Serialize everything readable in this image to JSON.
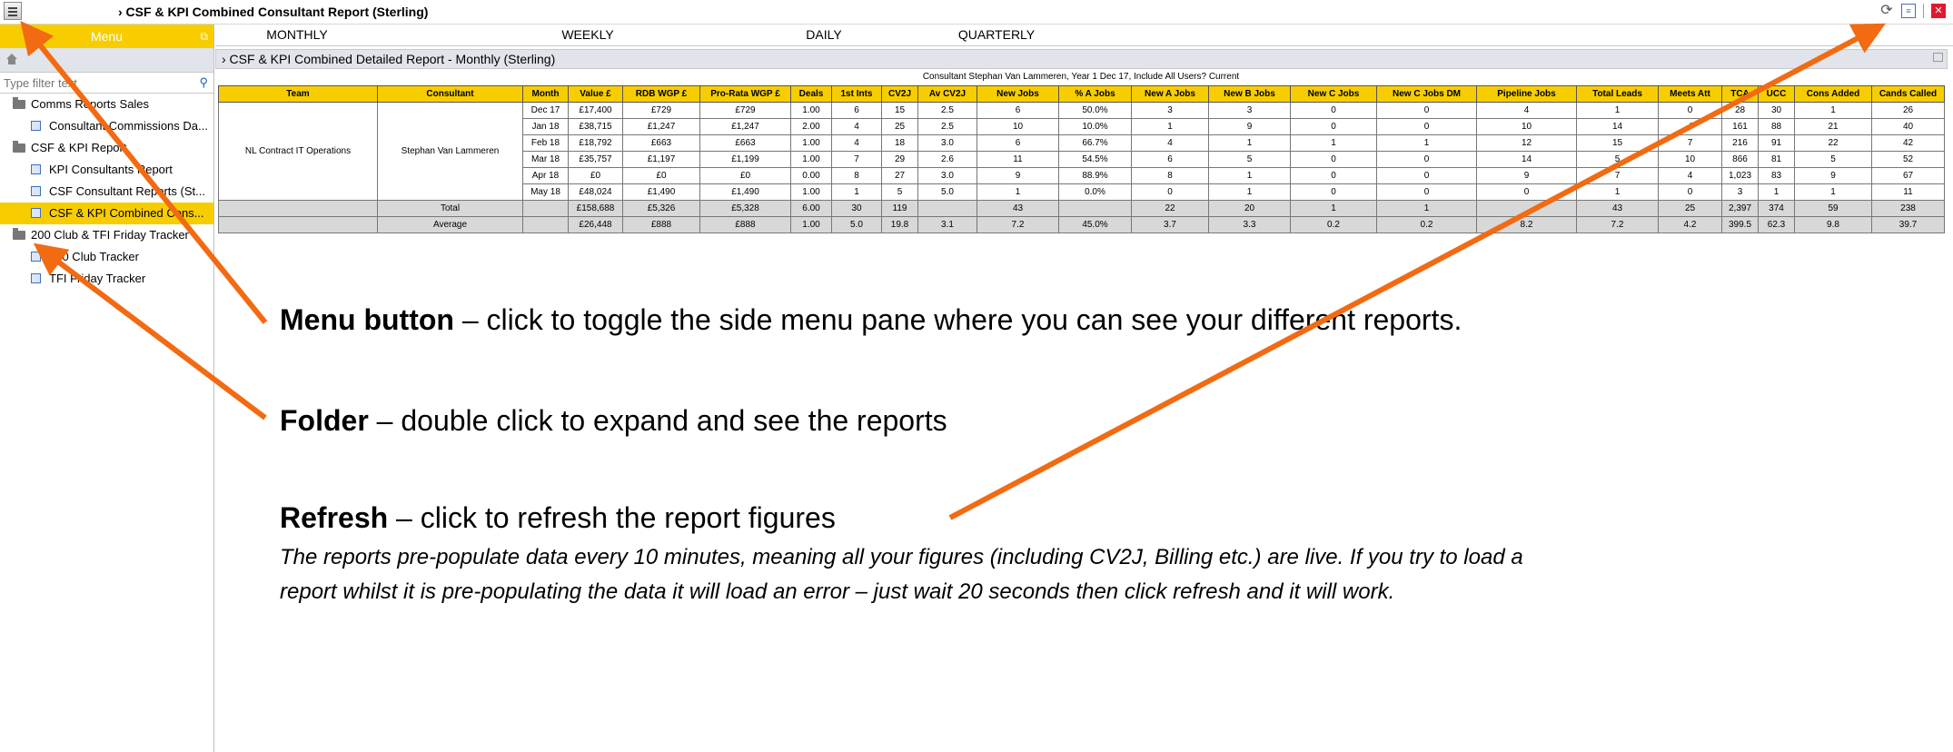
{
  "app": {
    "title": "› CSF & KPI Combined Consultant Report (Sterling)"
  },
  "sidebar": {
    "menu_label": "Menu",
    "filter_placeholder": "Type filter text",
    "items": [
      {
        "type": "folder",
        "label": "Comms Reports Sales",
        "level": 0
      },
      {
        "type": "report",
        "label": "Consultant Commissions Da...",
        "level": 1
      },
      {
        "type": "folder",
        "label": "CSF & KPI Report",
        "level": 0
      },
      {
        "type": "report",
        "label": "KPI Consultants Report",
        "level": 1
      },
      {
        "type": "report",
        "label": "CSF Consultant Reports (St...",
        "level": 1
      },
      {
        "type": "report",
        "label": "CSF & KPI Combined Cons...",
        "level": 1,
        "selected": true
      },
      {
        "type": "folder",
        "label": "200 Club & TFI Friday Tracker",
        "level": 0
      },
      {
        "type": "report",
        "label": "200 Club Tracker",
        "level": 1
      },
      {
        "type": "report",
        "label": "TFI Friday Tracker",
        "level": 1
      }
    ]
  },
  "tabs": [
    {
      "label": "MONTHLY",
      "active": true
    },
    {
      "label": "WEEKLY",
      "active": false
    },
    {
      "label": "DAILY",
      "active": false
    },
    {
      "label": "QUARTERLY",
      "active": false
    }
  ],
  "report": {
    "panel_title": "› CSF & KPI Combined Detailed Report - Monthly (Sterling)",
    "subtitle": "Consultant Stephan Van Lammeren, Year 1 Dec 17, Include All Users? Current",
    "team": "NL Contract IT Operations",
    "consultant": "Stephan Van Lammeren",
    "columns": [
      "Team",
      "Consultant",
      "Month",
      "Value £",
      "RDB WGP £",
      "Pro-Rata WGP £",
      "Deals",
      "1st Ints",
      "CV2J",
      "Av CV2J",
      "New Jobs",
      "% A Jobs",
      "New A Jobs",
      "New B Jobs",
      "New C Jobs",
      "New C Jobs DM",
      "Pipeline Jobs",
      "Total Leads",
      "Meets Att",
      "TCA",
      "UCC",
      "Cons Added",
      "Cands Called"
    ],
    "rows": [
      [
        "Dec 17",
        "£17,400",
        "£729",
        "£729",
        "1.00",
        "6",
        "15",
        "2.5",
        "6",
        "50.0%",
        "3",
        "3",
        "0",
        "0",
        "4",
        "1",
        "0",
        "28",
        "30",
        "1",
        "26"
      ],
      [
        "Jan 18",
        "£38,715",
        "£1,247",
        "£1,247",
        "2.00",
        "4",
        "25",
        "2.5",
        "10",
        "10.0%",
        "1",
        "9",
        "0",
        "0",
        "10",
        "14",
        "4",
        "161",
        "88",
        "21",
        "40"
      ],
      [
        "Feb 18",
        "£18,792",
        "£663",
        "£663",
        "1.00",
        "4",
        "18",
        "3.0",
        "6",
        "66.7%",
        "4",
        "1",
        "1",
        "1",
        "12",
        "15",
        "7",
        "216",
        "91",
        "22",
        "42"
      ],
      [
        "Mar 18",
        "£35,757",
        "£1,197",
        "£1,199",
        "1.00",
        "7",
        "29",
        "2.6",
        "11",
        "54.5%",
        "6",
        "5",
        "0",
        "0",
        "14",
        "5",
        "10",
        "866",
        "81",
        "5",
        "52"
      ],
      [
        "Apr 18",
        "£0",
        "£0",
        "£0",
        "0.00",
        "8",
        "27",
        "3.0",
        "9",
        "88.9%",
        "8",
        "1",
        "0",
        "0",
        "9",
        "7",
        "4",
        "1,023",
        "83",
        "9",
        "67"
      ],
      [
        "May 18",
        "£48,024",
        "£1,490",
        "£1,490",
        "1.00",
        "1",
        "5",
        "5.0",
        "1",
        "0.0%",
        "0",
        "1",
        "0",
        "0",
        "0",
        "1",
        "0",
        "3",
        "1",
        "1",
        "11"
      ]
    ],
    "total": [
      "Total",
      "",
      "£158,688",
      "£5,326",
      "£5,328",
      "6.00",
      "30",
      "119",
      "",
      "43",
      "",
      "22",
      "20",
      "1",
      "1",
      "",
      "43",
      "25",
      "2,397",
      "374",
      "59",
      "238"
    ],
    "average": [
      "Average",
      "",
      "£26,448",
      "£888",
      "£888",
      "1.00",
      "5.0",
      "19.8",
      "3.1",
      "7.2",
      "45.0%",
      "3.7",
      "3.3",
      "0.2",
      "0.2",
      "8.2",
      "7.2",
      "4.2",
      "399.5",
      "62.3",
      "9.8",
      "39.7"
    ]
  },
  "annotations": {
    "menu_title": "Menu button",
    "menu_desc": " – click to toggle the side menu pane where you can see your different reports.",
    "folder_title": "Folder",
    "folder_desc": " – double click to expand and see the reports",
    "refresh_title": "Refresh",
    "refresh_desc": " – click to refresh the report figures",
    "note_line1": "The reports pre-populate data every 10 minutes, meaning all your figures (including CV2J, Billing etc.) are live.  If you try to load a",
    "note_line2": "report whilst it is pre-populating the data it will load an error – just wait 20 seconds then click refresh and it will work."
  },
  "colors": {
    "accent_yellow": "#f7cd00",
    "arrow_orange": "#f26a12",
    "panel_grey": "#e1e4ea"
  }
}
